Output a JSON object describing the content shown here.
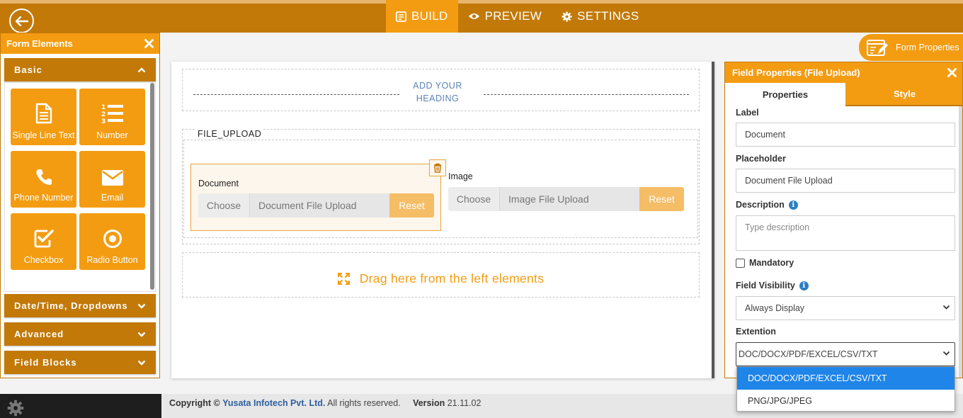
{
  "colors": {
    "brand_dark": "#c27908",
    "brand": "#f39c12",
    "accent_blue": "#5a83b7"
  },
  "topbar": {
    "back_icon": "arrow-left-icon",
    "tabs": [
      {
        "label": "BUILD",
        "icon": "form-icon",
        "active": true
      },
      {
        "label": "PREVIEW",
        "icon": "eye-icon",
        "active": false
      },
      {
        "label": "SETTINGS",
        "icon": "gear-icon",
        "active": false
      }
    ]
  },
  "left_panel": {
    "title": "Form Elements",
    "sections": {
      "basic": "Basic",
      "datetime": "Date/Time, Dropdowns",
      "advanced": "Advanced",
      "field_blocks": "Field Blocks"
    },
    "tiles": [
      {
        "label": "Single Line Text",
        "icon": "document-icon"
      },
      {
        "label": "Number",
        "icon": "numbered-list-icon"
      },
      {
        "label": "Phone Number",
        "icon": "phone-icon"
      },
      {
        "label": "Email",
        "icon": "envelope-icon"
      },
      {
        "label": "Checkbox",
        "icon": "checkbox-icon"
      },
      {
        "label": "Radio Button",
        "icon": "radio-icon"
      }
    ]
  },
  "canvas": {
    "heading_placeholder": "ADD YOUR HEADING",
    "section_title": "FILE_UPLOAD",
    "fields": [
      {
        "label": "Document",
        "choose": "Choose",
        "placeholder": "Document File Upload",
        "reset": "Reset"
      },
      {
        "label": "Image",
        "choose": "Choose",
        "placeholder": "Image File Upload",
        "reset": "Reset"
      }
    ],
    "drop_hint": "Drag here from the left elements"
  },
  "form_properties": {
    "label": "Form Properties"
  },
  "right_panel": {
    "title": "Field Properties (File Upload)",
    "tabs": {
      "properties": "Properties",
      "style": "Style"
    },
    "label_label": "Label",
    "label_value": "Document",
    "placeholder_label": "Placeholder",
    "placeholder_value": "Document File Upload",
    "description_label": "Description",
    "description_placeholder": "Type description",
    "mandatory_label": "Mandatory",
    "visibility_label": "Field Visibility",
    "visibility_value": "Always Display",
    "extension_label": "Extention",
    "extension_value": "DOC/DOCX/PDF/EXCEL/CSV/TXT",
    "extension_options": [
      "DOC/DOCX/PDF/EXCEL/CSV/TXT",
      "PNG/JPG/JPEG"
    ]
  },
  "footer": {
    "copyright_prefix": "Copyright ©",
    "company": "Yusata Infotech Pvt. Ltd.",
    "rights": "All rights reserved.",
    "version_label": "Version",
    "version_value": "21.11.02"
  }
}
